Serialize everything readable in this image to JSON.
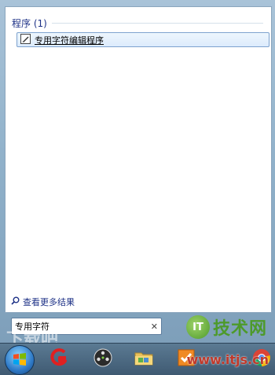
{
  "results": {
    "section_title": "程序 (1)",
    "items": [
      {
        "label": "专用字符编辑程序",
        "icon": "private-character-editor-icon"
      }
    ]
  },
  "see_more": {
    "label": "查看更多结果",
    "icon": "search-icon"
  },
  "search": {
    "value": "专用字符",
    "clear_symbol": "✕"
  },
  "watermark": {
    "left_text": "下载吧",
    "logo_letter": "IT",
    "brand_text": "技术网",
    "url": "www.itjs.cn"
  },
  "taskbar": {
    "items": [
      {
        "name": "start-orb",
        "icon": "windows-logo-icon"
      },
      {
        "name": "taskbar-app-red-g",
        "icon": "red-g-icon"
      },
      {
        "name": "taskbar-app-film",
        "icon": "film-reel-icon"
      },
      {
        "name": "taskbar-app-folder",
        "icon": "folder-icon"
      },
      {
        "name": "taskbar-app-check",
        "icon": "checkbox-icon"
      },
      {
        "name": "taskbar-app-chrome",
        "icon": "chrome-icon"
      }
    ]
  },
  "colors": {
    "accent": "#1e3287",
    "highlight_border": "#7da2ce",
    "watermark_green": "#4d9a2a",
    "watermark_red": "#c0392b"
  }
}
